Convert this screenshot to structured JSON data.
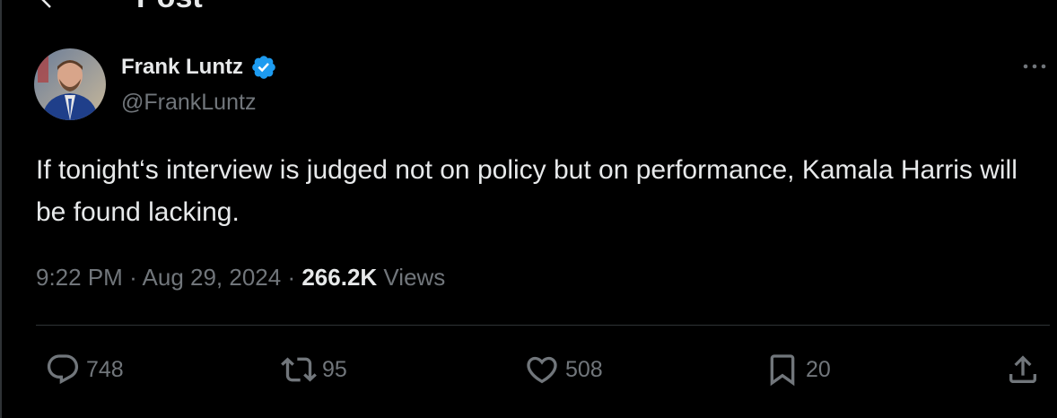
{
  "header": {
    "title": "Post"
  },
  "author": {
    "name": "Frank Luntz",
    "handle": "@FrankLuntz",
    "verified": true
  },
  "tweet": {
    "text": "If tonight‘s interview is judged not on policy but on performance, Kamala Harris will be found lacking.",
    "time": "9:22 PM",
    "date": "Aug 29, 2024",
    "views": "266.2K",
    "views_label": "Views"
  },
  "actions": {
    "replies": "748",
    "reposts": "95",
    "likes": "508",
    "bookmarks": "20"
  },
  "colors": {
    "background": "#000000",
    "text": "#e7e9ea",
    "muted": "#71767b",
    "verified": "#1d9bf0",
    "divider": "#2f3336"
  }
}
